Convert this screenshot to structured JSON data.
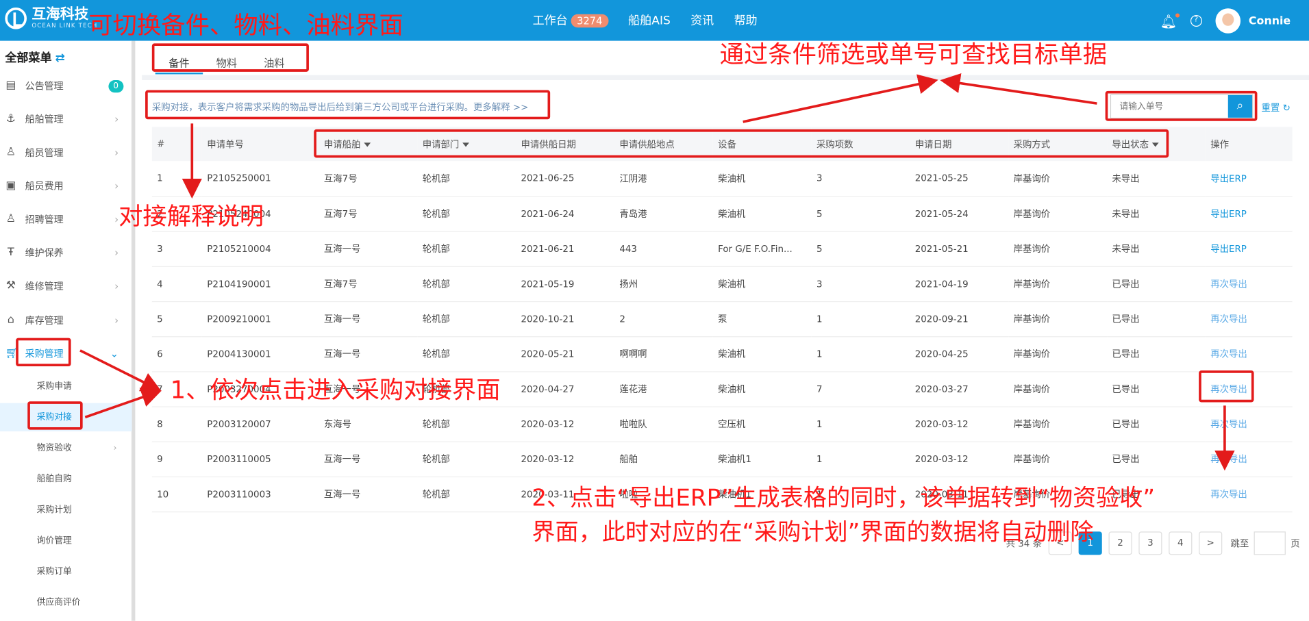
{
  "app": {
    "logo_name": "互海科技",
    "logo_en": "OCEAN LINK TECH",
    "user": "Connie"
  },
  "nav": {
    "workbench": "工作台",
    "badge": "3274",
    "ais": "船舶AIS",
    "news": "资讯",
    "help": "帮助"
  },
  "sidebar": {
    "title": "全部菜单",
    "items": [
      {
        "label": "公告管理",
        "count": "0"
      },
      {
        "label": "船舶管理"
      },
      {
        "label": "船员管理"
      },
      {
        "label": "船员费用"
      },
      {
        "label": "招聘管理"
      },
      {
        "label": "维护保养"
      },
      {
        "label": "维修管理"
      },
      {
        "label": "库存管理"
      },
      {
        "label": "采购管理"
      }
    ],
    "sub": [
      "采购申请",
      "采购对接",
      "物资验收",
      "船舶自购",
      "采购计划",
      "询价管理",
      "采购订单",
      "供应商评价"
    ]
  },
  "tabs": [
    "备件",
    "物料",
    "油料"
  ],
  "notice": "采购对接，表示客户将需求采购的物品导出后给到第三方公司或平台进行采购。更多解释 >>",
  "search": {
    "placeholder": "请输入单号",
    "reset": "重置"
  },
  "table": {
    "headers": [
      "#",
      "申请单号",
      "申请船舶",
      "申请部门",
      "申请供船日期",
      "申请供船地点",
      "设备",
      "采购项数",
      "申请日期",
      "采购方式",
      "导出状态",
      "操作"
    ],
    "rows": [
      [
        "1",
        "P2105250001",
        "互海7号",
        "轮机部",
        "2021-06-25",
        "江阴港",
        "柴油机",
        "3",
        "2021-05-25",
        "岸基询价",
        "未导出",
        "导出ERP"
      ],
      [
        "2",
        "P2105240004",
        "互海7号",
        "轮机部",
        "2021-06-24",
        "青岛港",
        "柴油机",
        "5",
        "2021-05-24",
        "岸基询价",
        "未导出",
        "导出ERP"
      ],
      [
        "3",
        "P2105210004",
        "互海一号",
        "轮机部",
        "2021-06-21",
        "443",
        "For G/E F.O.Fin...",
        "5",
        "2021-05-21",
        "岸基询价",
        "未导出",
        "导出ERP"
      ],
      [
        "4",
        "P2104190001",
        "互海7号",
        "轮机部",
        "2021-05-19",
        "扬州",
        "柴油机",
        "3",
        "2021-04-19",
        "岸基询价",
        "已导出",
        "再次导出"
      ],
      [
        "5",
        "P2009210001",
        "互海一号",
        "轮机部",
        "2020-10-21",
        "2",
        "泵",
        "1",
        "2020-09-21",
        "岸基询价",
        "已导出",
        "再次导出"
      ],
      [
        "6",
        "P2004130001",
        "互海一号",
        "轮机部",
        "2020-05-21",
        "啊啊啊",
        "柴油机",
        "1",
        "2020-04-25",
        "岸基询价",
        "已导出",
        "再次导出"
      ],
      [
        "7",
        "P2003270004",
        "互海一号",
        "轮机部",
        "2020-04-27",
        "莲花港",
        "柴油机",
        "7",
        "2020-03-27",
        "岸基询价",
        "已导出",
        "再次导出"
      ],
      [
        "8",
        "P2003120007",
        "东海号",
        "轮机部",
        "2020-03-12",
        "啦啦队",
        "空压机",
        "1",
        "2020-03-12",
        "岸基询价",
        "已导出",
        "再次导出"
      ],
      [
        "9",
        "P2003110005",
        "互海一号",
        "轮机部",
        "2020-03-12",
        "船舶",
        "柴油机1",
        "1",
        "2020-03-12",
        "岸基询价",
        "已导出",
        "再次导出"
      ],
      [
        "10",
        "P2003110003",
        "互海一号",
        "轮机部",
        "2020-03-11",
        "啦啦",
        "柴油机1",
        "1",
        "2020-03-11",
        "岸基询价",
        "已导出",
        "再次导出"
      ]
    ]
  },
  "pager": {
    "total": "共 34 条",
    "pages": [
      "1",
      "2",
      "3",
      "4"
    ],
    "next": ">",
    "goto": "跳至",
    "unit": "页"
  },
  "annotations": {
    "tabs": "可切换备件、物料、油料界面",
    "search": "通过条件筛选或单号可查找目标单据",
    "notice": "对接解释说明",
    "step1": "1、依次点击进入采购对接界面",
    "step2_line1": "2、点击“导出ERP”生成表格的同时，该单据转到“物资验收”",
    "step2_line2": "界面，此时对应的在“采购计划”界面的数据将自动删除"
  },
  "colors": {
    "brand": "#1296db",
    "annotation": "#ff1a1a"
  }
}
